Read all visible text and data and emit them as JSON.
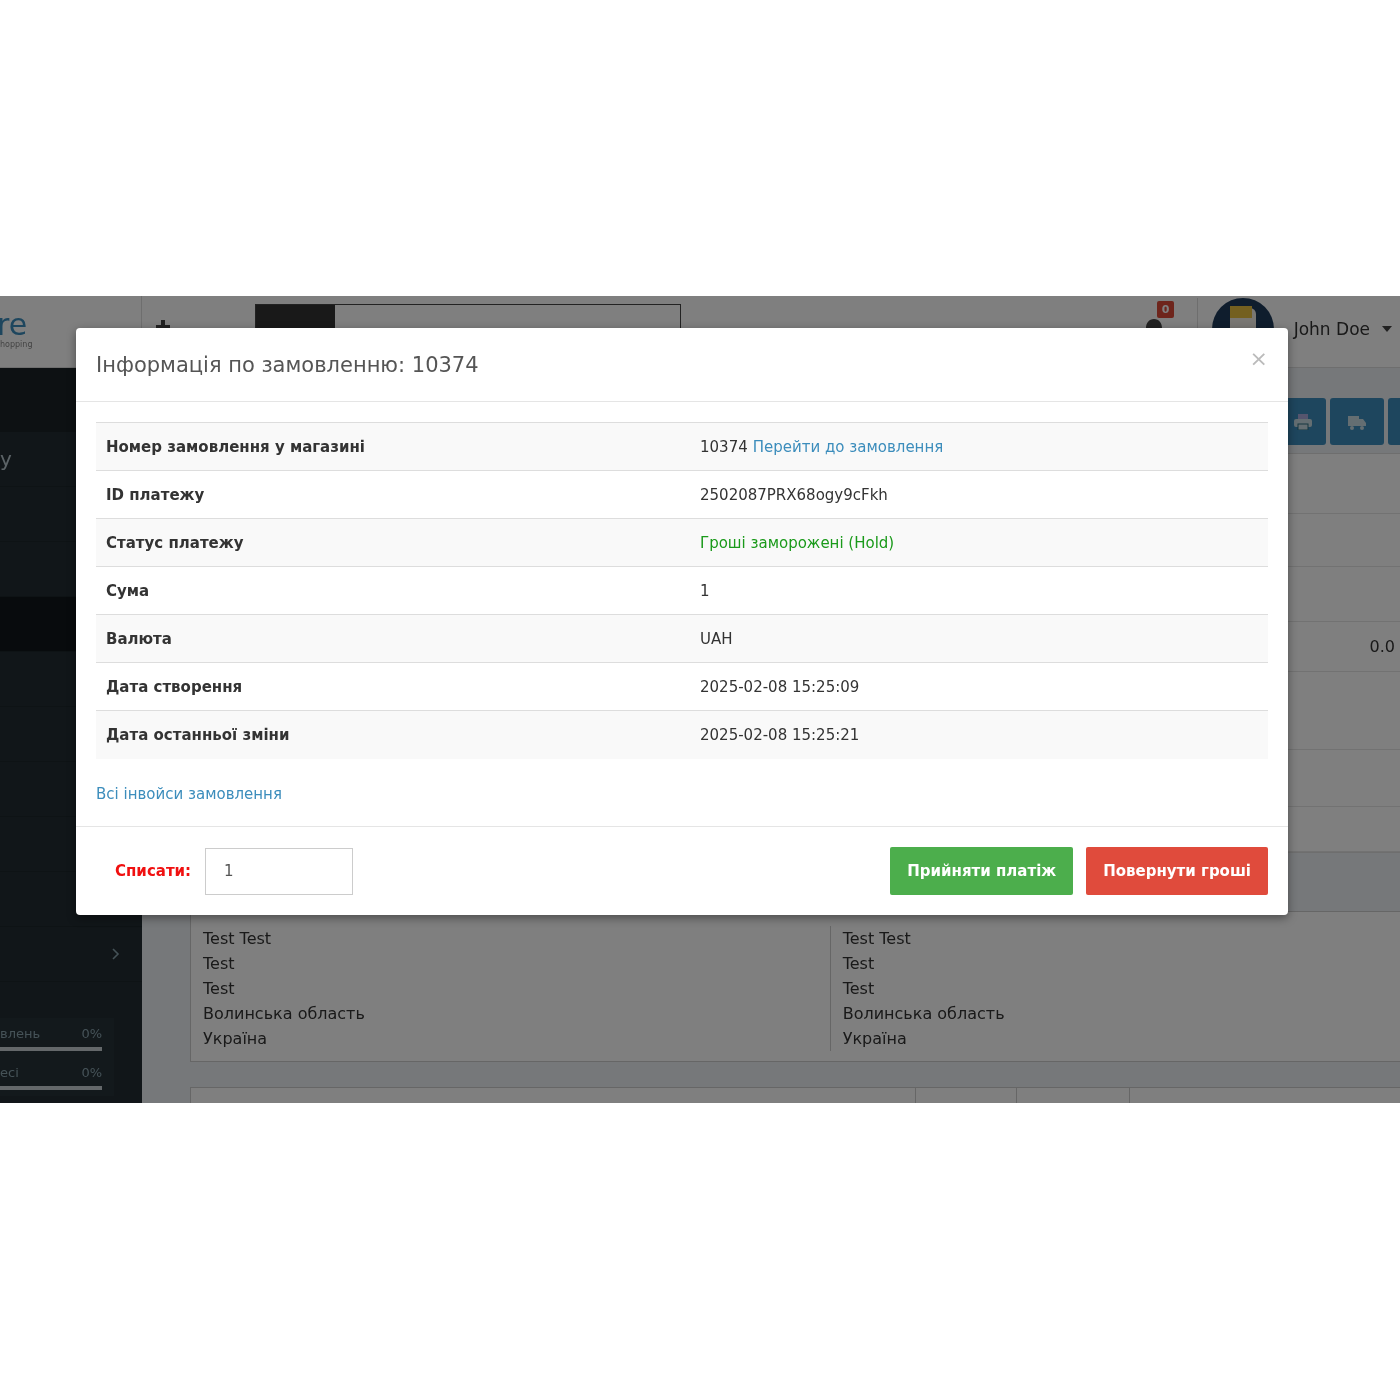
{
  "header": {
    "logo": "re",
    "logo_tagline": "hopping",
    "notifications_badge": "0",
    "user_name": "John Doe"
  },
  "sidebar": {
    "items": [
      {
        "label": "y",
        "selected": false,
        "kind": "link"
      },
      {
        "selected": false,
        "kind": "link"
      },
      {
        "selected": false,
        "kind": "link"
      },
      {
        "selected": true,
        "kind": "link"
      },
      {
        "selected": false,
        "kind": "link"
      },
      {
        "selected": false,
        "kind": "link"
      },
      {
        "selected": false,
        "kind": "link"
      },
      {
        "selected": false,
        "kind": "link"
      },
      {
        "selected": false,
        "kind": "link"
      },
      {
        "selected": false,
        "kind": "submenu"
      }
    ],
    "progress": [
      {
        "label": "влень",
        "value": "0%"
      },
      {
        "label": "есі",
        "value": "0%"
      }
    ]
  },
  "content": {
    "total_fragment": "0.0",
    "addresses": [
      [
        "Test Test",
        "Test",
        "Test",
        "Волинська область",
        "Україна"
      ],
      [
        "Test Test",
        "Test",
        "Test",
        "Волинська область",
        "Україна"
      ]
    ]
  },
  "modal": {
    "title": "Інформація по замовленню: 10374",
    "close": "×",
    "rows": [
      {
        "label": "Номер замовлення у магазині",
        "value": "10374",
        "link": "Перейти до замовлення",
        "kind": "link"
      },
      {
        "label": "ID платежу",
        "value": "2502087PRX68ogy9cFkh",
        "kind": "text"
      },
      {
        "label": "Статус платежу",
        "value": "Гроші заморожені (Hold)",
        "kind": "status"
      },
      {
        "label": "Сума",
        "value": "1",
        "kind": "text"
      },
      {
        "label": "Валюта",
        "value": "UAH",
        "kind": "text"
      },
      {
        "label": "Дата створення",
        "value": "2025-02-08 15:25:09",
        "kind": "text"
      },
      {
        "label": "Дата останньої зміни",
        "value": "2025-02-08 15:25:21",
        "kind": "text"
      }
    ],
    "invoices_link": "Всі інвойси замовлення",
    "capture_label": "Списати:",
    "capture_amount": "1",
    "buttons": [
      {
        "label": "Прийняти платіж",
        "kind": "accept"
      },
      {
        "label": "Повернути гроші",
        "kind": "refund"
      }
    ]
  }
}
